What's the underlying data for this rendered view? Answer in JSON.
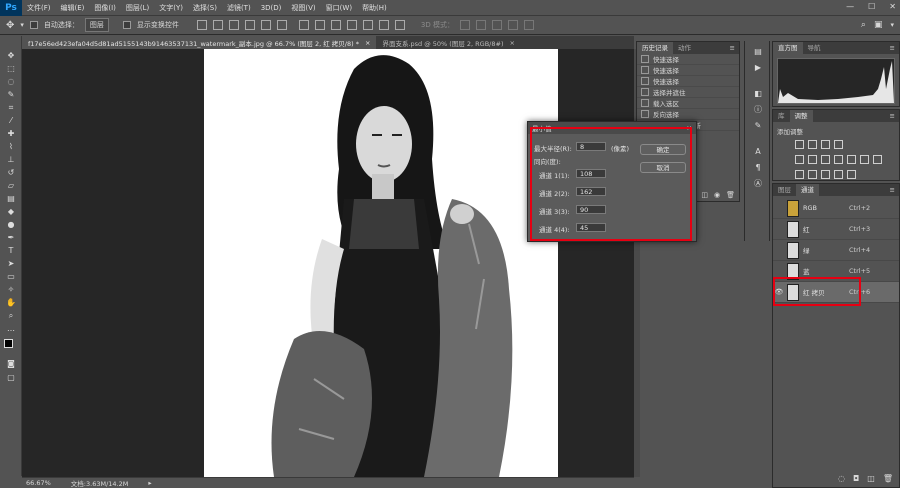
{
  "menubar": {
    "logo": "Ps",
    "items": [
      "文件(F)",
      "编辑(E)",
      "图像(I)",
      "图层(L)",
      "文字(Y)",
      "选择(S)",
      "滤镜(T)",
      "3D(D)",
      "视图(V)",
      "窗口(W)",
      "帮助(H)"
    ],
    "controls": [
      "—",
      "☐",
      "✕"
    ]
  },
  "options": {
    "auto_select_label": "自动选择：",
    "auto_select_value": "图层",
    "show_transform_label": "显示变换控件",
    "mode_3d_label": "3D 模式："
  },
  "tabs": [
    {
      "label": "f17e56ed423efa04d5d81ad5155143b91463537131_watermark_副本.jpg @ 66.7% (图层 2, 红 拷贝/8) *",
      "close": "×",
      "active": true
    },
    {
      "label": "界面支系.psd @ 50% (图层 2, RGB/8#)",
      "close": "×",
      "active": false
    }
  ],
  "status": {
    "zoom": "66.67%",
    "doc": "文档:3.63M/14.2M",
    "arrow": "▸"
  },
  "history": {
    "tabs": [
      "历史记录",
      "动作"
    ],
    "items": [
      "快速选择",
      "快速选择",
      "快速选择",
      "选择并遮住",
      "载入选区",
      "反向选择",
      "新"
    ]
  },
  "histogram_panel": {
    "tabs": [
      "直方图",
      "导航"
    ]
  },
  "adjust_panel": {
    "tabs": [
      "库",
      "调整"
    ],
    "add_label": "添加调整"
  },
  "channels_panel": {
    "tabs": [
      "图层",
      "通道"
    ],
    "rows": [
      {
        "name": "RGB",
        "key": "Ctrl+2",
        "eye": ""
      },
      {
        "name": "红",
        "key": "Ctrl+3",
        "eye": ""
      },
      {
        "name": "绿",
        "key": "Ctrl+4",
        "eye": ""
      },
      {
        "name": "蓝",
        "key": "Ctrl+5",
        "eye": ""
      },
      {
        "name": "红 拷贝",
        "key": "Ctrl+6",
        "eye": "👁"
      }
    ]
  },
  "dialog": {
    "title": "最小值",
    "close": "×",
    "radius_label": "最大半径(R):",
    "radius_value": "8",
    "radius_unit": "(像素)",
    "angle_label": "同向(度):",
    "ok": "确定",
    "cancel": "取消",
    "channels": [
      {
        "label": "通道 1(1):",
        "value": "108"
      },
      {
        "label": "通道 2(2):",
        "value": "162"
      },
      {
        "label": "通道 3(3):",
        "value": "90"
      },
      {
        "label": "通道 4(4):",
        "value": "45"
      }
    ]
  },
  "colors": {
    "highlight": "#e60012",
    "ui_bg": "#535353",
    "canvas_bg": "#262626"
  }
}
